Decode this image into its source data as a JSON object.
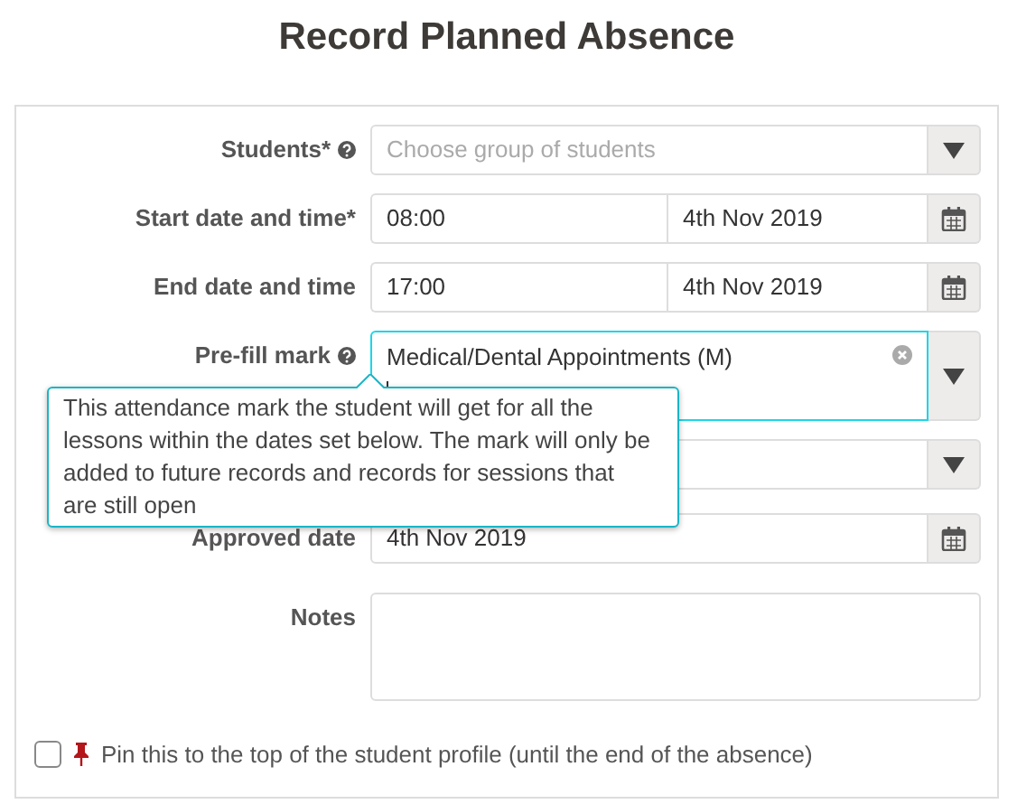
{
  "title": "Record Planned Absence",
  "fields": [
    {
      "kind": "select",
      "label": "Students*",
      "help": true,
      "placeholder": "Choose group of students"
    },
    {
      "kind": "datetime",
      "label": "Start date and time*",
      "time": "08:00",
      "date": "4th Nov 2019"
    },
    {
      "kind": "datetime",
      "label": "End date and time",
      "time": "17:00",
      "date": "4th Nov 2019"
    },
    {
      "kind": "tags",
      "label": "Pre-fill mark",
      "help": true,
      "value": "Medical/Dental Appointments (M)",
      "focused": true
    },
    {
      "kind": "select"
    },
    {
      "kind": "date",
      "label": "Approved date",
      "date": "4th Nov 2019"
    },
    {
      "kind": "textarea",
      "label": "Notes"
    }
  ],
  "tooltip": "This attendance mark the student will get for all the lessons within the dates set below. The mark will only be added to future records and records for sessions that are still open",
  "pin": {
    "label": "Pin this to the top of the student profile (until the end of the absence)",
    "checked": false
  }
}
